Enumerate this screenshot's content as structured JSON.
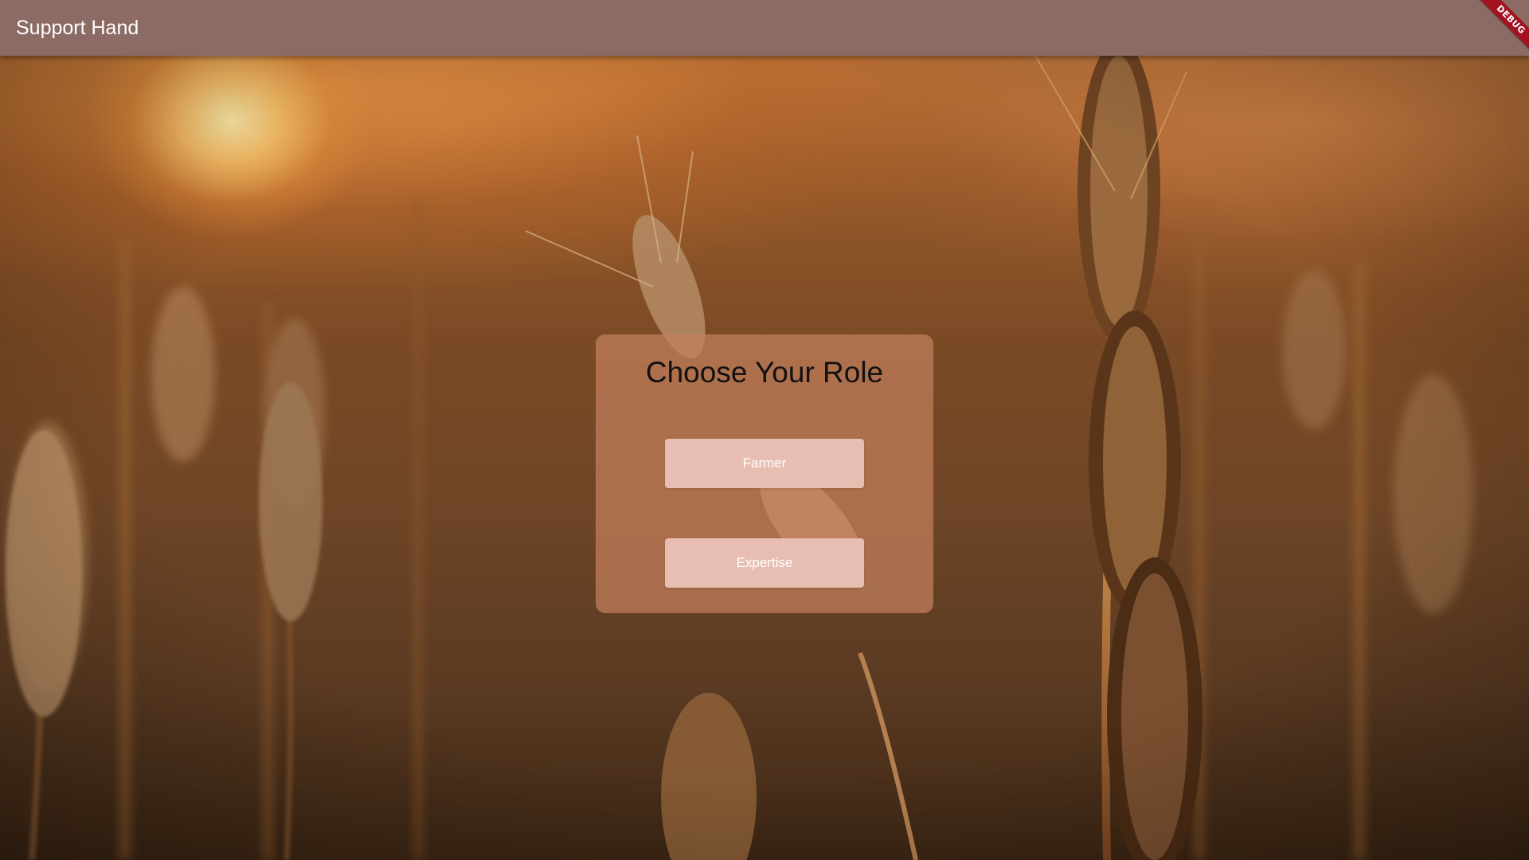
{
  "app_bar": {
    "title": "Support Hand",
    "color": "#8b6b64"
  },
  "debug_banner": {
    "label": "DEBUG",
    "color": "#a3131f"
  },
  "role_selection": {
    "heading": "Choose Your Role",
    "buttons": [
      {
        "label": "Farmer",
        "color": "#e9beb2"
      },
      {
        "label": "Expertise",
        "color": "#e9beb2"
      }
    ]
  },
  "background": {
    "image_subject": "wheat-field-at-sunset"
  }
}
